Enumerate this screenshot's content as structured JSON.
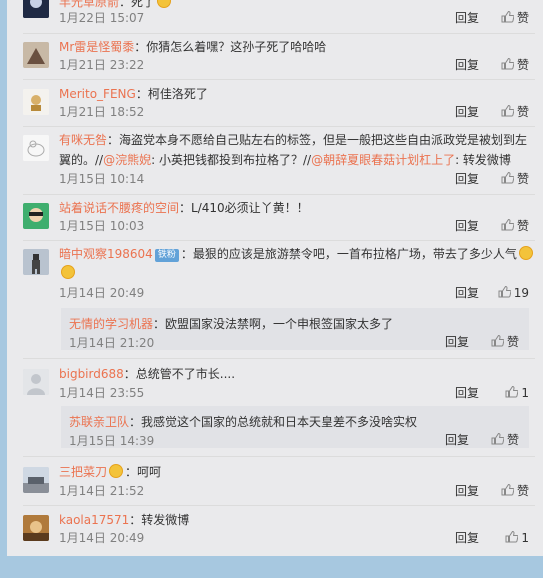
{
  "comments": [
    {
      "user": "丰光草原箭",
      "text": "：死了",
      "time": "1月22日 15:07",
      "reply": "回复",
      "likes": "赞"
    },
    {
      "user": "Mr雷是怪蜀黍",
      "text": "：你猜怎么着嘿？这孙子死了哈哈哈",
      "time": "1月21日 23:22",
      "reply": "回复",
      "likes": "赞"
    },
    {
      "user": "Merito_FENG",
      "text": "：柯佳洛死了",
      "time": "1月21日 18:52",
      "reply": "回复",
      "likes": "赞"
    },
    {
      "user": "有咪无咎",
      "text_line1": "：海盗党本身不愿给自己贴左右的标签，但是一般把这些自由派政党是被划到左",
      "text_line2_prefix": "翼的。//",
      "mention1": "@浣熊婗",
      "text_line2_mid": ": 小英把钱都投到布拉格了？//",
      "mention2": "@朝辞夏眼春菇计划杠上了",
      "text_line2_suffix": ": 转发微博",
      "time": "1月15日 10:14",
      "reply": "回复",
      "likes": "赞"
    },
    {
      "user": "站着说话不腰疼的空间",
      "text": "：L/410必须让丫黄！！",
      "time": "1月15日 10:03",
      "reply": "回复",
      "likes": "赞"
    },
    {
      "user": "暗中观察198604",
      "badge": "铁粉",
      "text": "：最狠的应该是旅游禁令吧，一首布拉格广场，带去了多少人气",
      "time": "1月14日 20:49",
      "reply": "回复",
      "likes": "19",
      "sub": {
        "user": "无情的学习机器",
        "text": "：欧盟国家没法禁啊，一个申根签国家太多了",
        "time": "1月14日 21:20",
        "reply": "回复",
        "likes": "赞"
      }
    },
    {
      "user": "bigbird688",
      "text": "：总统管不了市长....",
      "time": "1月14日 23:55",
      "reply": "回复",
      "likes": "1",
      "sub": {
        "user": "苏联亲卫队",
        "text": "：我感觉这个国家的总统就和日本天皇差不多没啥实权",
        "time": "1月15日 14:39",
        "reply": "回复",
        "likes": "赞"
      }
    },
    {
      "user": "三把菜刀",
      "text": "：呵呵",
      "time": "1月14日 21:52",
      "reply": "回复",
      "likes": "赞"
    },
    {
      "user": "kaola17571",
      "text": "：转发微博",
      "time": "1月14日 20:49",
      "reply": "回复",
      "likes": "1"
    }
  ],
  "colors": {
    "accent": "#eb7350",
    "link": "#eb7350",
    "page_bg": "#a7c8e0",
    "panel_bg": "#eaeaec",
    "subpanel_bg": "#e1e2e6"
  },
  "icons": {
    "like": "thumbs-up-icon",
    "emoji": "laughing-face-icon"
  }
}
